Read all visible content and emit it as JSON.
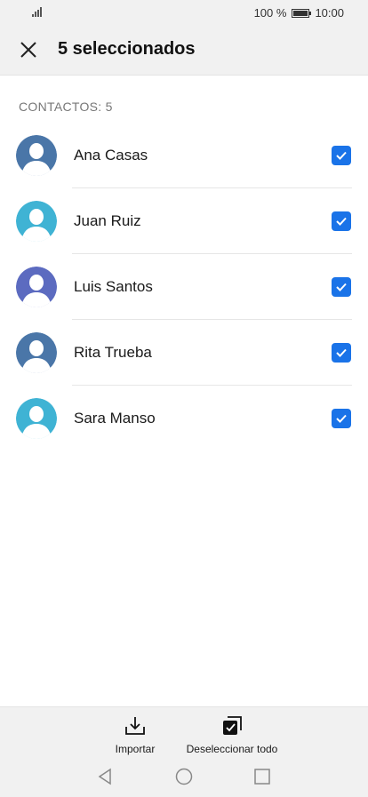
{
  "status_bar": {
    "battery_text": "100 %",
    "time": "10:00",
    "battery_level": 1.0
  },
  "header": {
    "title": "5 seleccionados",
    "close_icon": "close-icon"
  },
  "section": {
    "label": "CONTACTOS: 5"
  },
  "contacts": [
    {
      "name": "Ana Casas",
      "avatar_color": "#4a76a8",
      "checked": true
    },
    {
      "name": "Juan Ruiz",
      "avatar_color": "#3fb3d4",
      "checked": true
    },
    {
      "name": "Luis Santos",
      "avatar_color": "#5c6bc0",
      "checked": true
    },
    {
      "name": "Rita Trueba",
      "avatar_color": "#4a76a8",
      "checked": true
    },
    {
      "name": "Sara Manso",
      "avatar_color": "#3fb3d4",
      "checked": true
    }
  ],
  "bottom_actions": {
    "import_label": "Importar",
    "deselect_label": "Deseleccionar todo"
  },
  "colors": {
    "accent": "#1a73e8",
    "bar_bg": "#f1f1f1"
  }
}
